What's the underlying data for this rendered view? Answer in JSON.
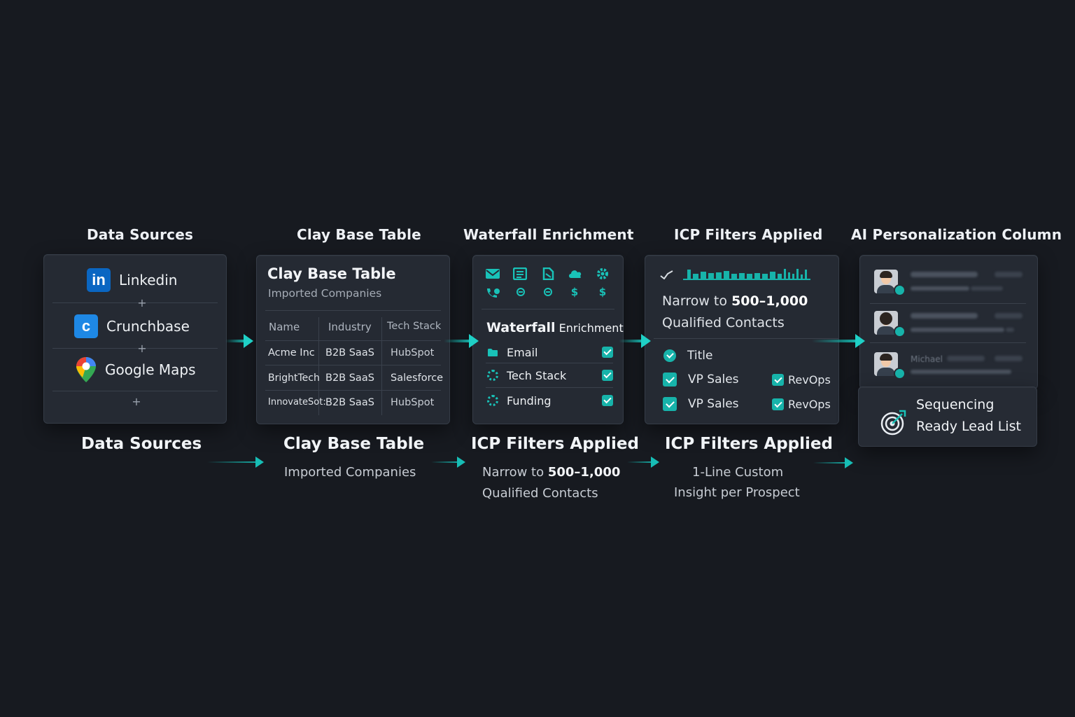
{
  "stage_titles": [
    "Data Sources",
    "Clay Base Table",
    "Waterfall Enrichment",
    "ICP Filters Applied",
    "AI Personalization Column"
  ],
  "sources": {
    "items": [
      {
        "label": "Linkedin",
        "icon": "linkedin-icon"
      },
      {
        "label": "Crunchbase",
        "icon": "crunchbase-icon"
      },
      {
        "label": "Google Maps",
        "icon": "google-maps-icon"
      }
    ],
    "plus": "+"
  },
  "clay_table": {
    "title": "Clay Base Table",
    "subtitle": "Imported Companies",
    "columns": [
      "Name",
      "Industry",
      "Tech Stack"
    ],
    "rows": [
      [
        "Acme Inc",
        "B2B SaaS",
        "HubSpot"
      ],
      [
        "BrightTech",
        "B2B SaaS",
        "Salesforce"
      ],
      [
        "InnovateSot:",
        "B2B SaaS",
        "HubSpot"
      ]
    ]
  },
  "enrichment": {
    "title_bold": "Waterfall",
    "title_rest": "Enrichment",
    "icons_top": [
      "mail-icon",
      "list-icon",
      "document-icon",
      "cloud-icon",
      "gear-icon"
    ],
    "icons_bottom": [
      "phone-icon",
      "coin-icon",
      "coin-icon",
      "dollar-icon",
      "dollar-icon"
    ],
    "bottom_glyphs": [
      "$",
      "$"
    ],
    "items": [
      {
        "label": "Email",
        "icon": "folder-icon",
        "checked": true
      },
      {
        "label": "Tech Stack",
        "icon": "gear-icon",
        "checked": true
      },
      {
        "label": "Funding",
        "icon": "gear-icon",
        "checked": true
      }
    ]
  },
  "icp": {
    "narrow_prefix": "Narrow to",
    "narrow_value": "500–1,000",
    "narrow_suffix": "Qualified Contacts",
    "title_option": "Title",
    "options": [
      {
        "left": "VP Sales",
        "right": "RevOps"
      },
      {
        "left": "VP Sales",
        "right": "RevOps"
      }
    ]
  },
  "ai": {
    "visible_name": "Michael",
    "sequencing_line1": "Sequencing",
    "sequencing_line2": "Ready Lead List"
  },
  "bottom": [
    {
      "title": "Data Sources",
      "sub": []
    },
    {
      "title": "Clay Base Table",
      "sub": [
        "Imported Companies"
      ]
    },
    {
      "title": "ICP Filters Applied",
      "sub_prefix": "Narrow to",
      "sub_value": "500–1,000",
      "sub2": "Qualified Contacts"
    },
    {
      "title": "ICP Filters Applied",
      "sub": [
        "1-Line Custom",
        "Insight per Prospect"
      ]
    }
  ],
  "colors": {
    "accent": "#17b3aa",
    "background": "#171a20",
    "card": "#252a33"
  }
}
